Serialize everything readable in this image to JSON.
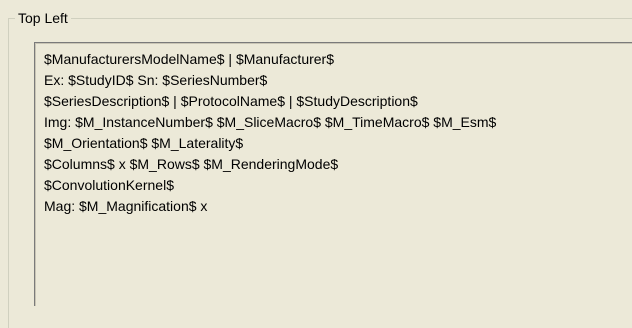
{
  "group": {
    "title": "Top Left"
  },
  "text_lines": [
    "$ManufacturersModelName$ | $Manufacturer$",
    "Ex: $StudyID$ Sn: $SeriesNumber$",
    "$SeriesDescription$ | $ProtocolName$ | $StudyDescription$",
    "Img: $M_InstanceNumber$ $M_SliceMacro$ $M_TimeMacro$ $M_Esm$",
    "$M_Orientation$ $M_Laterality$",
    "$Columns$ x $M_Rows$ $M_RenderingMode$",
    "$ConvolutionKernel$",
    "Mag: $M_Magnification$ x"
  ]
}
